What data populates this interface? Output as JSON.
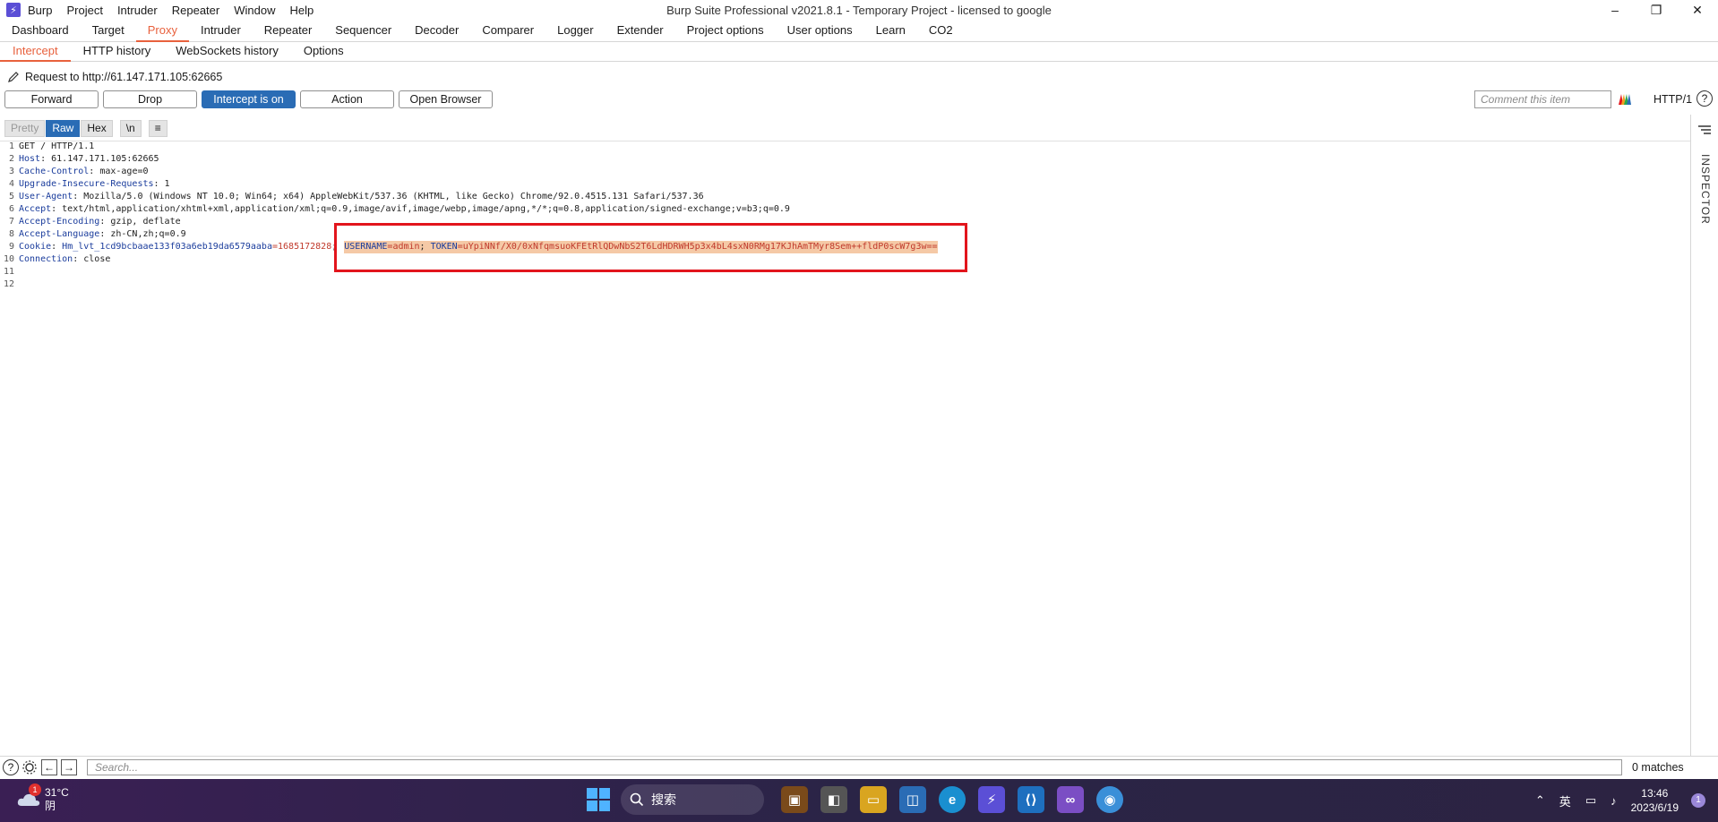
{
  "window": {
    "title": "Burp Suite Professional v2021.8.1 - Temporary Project - licensed to google",
    "logo": "burp-logo",
    "menu": [
      "Burp",
      "Project",
      "Intruder",
      "Repeater",
      "Window",
      "Help"
    ],
    "controls": {
      "minimize": "–",
      "restore": "❐",
      "close": "✕"
    }
  },
  "main_tabs": [
    "Dashboard",
    "Target",
    "Proxy",
    "Intruder",
    "Repeater",
    "Sequencer",
    "Decoder",
    "Comparer",
    "Logger",
    "Extender",
    "Project options",
    "User options",
    "Learn",
    "CO2"
  ],
  "main_tab_active": "Proxy",
  "sub_tabs": [
    "Intercept",
    "HTTP history",
    "WebSockets history",
    "Options"
  ],
  "sub_tab_active": "Intercept",
  "request": {
    "label": "Request to http://61.147.171.105:62665"
  },
  "actions": {
    "forward": "Forward",
    "drop": "Drop",
    "intercept": "Intercept is on",
    "action": "Action",
    "open_browser": "Open Browser"
  },
  "comment": {
    "placeholder": "Comment this item"
  },
  "protocol": "HTTP/1",
  "help": "?",
  "view_modes": {
    "pretty": "Pretty",
    "raw": "Raw",
    "hex": "Hex",
    "newline": "\\n",
    "menu": "≡"
  },
  "inspector_label": "INSPECTOR",
  "code_lines": {
    "l1": {
      "n": "1",
      "text": "GET / HTTP/1.1"
    },
    "l2": {
      "n": "2",
      "key": "Host",
      "val": ": 61.147.171.105:62665"
    },
    "l3": {
      "n": "3",
      "key": "Cache-Control",
      "val": ": max-age=0"
    },
    "l4": {
      "n": "4",
      "key": "Upgrade-Insecure-Requests",
      "val": ": 1"
    },
    "l5": {
      "n": "5",
      "key": "User-Agent",
      "val": ": Mozilla/5.0 (Windows NT 10.0; Win64; x64) AppleWebKit/537.36 (KHTML, like Gecko) Chrome/92.0.4515.131 Safari/537.36"
    },
    "l6": {
      "n": "6",
      "key": "Accept",
      "val": ": text/html,application/xhtml+xml,application/xml;q=0.9,image/avif,image/webp,image/apng,*/*;q=0.8,application/signed-exchange;v=b3;q=0.9"
    },
    "l7": {
      "n": "7",
      "key": "Accept-Encoding",
      "val": ": gzip, deflate"
    },
    "l8": {
      "n": "8",
      "key": "Accept-Language",
      "val": ": zh-CN,zh;q=0.9"
    },
    "l9": {
      "n": "9",
      "key": "Cookie",
      "sep": ": ",
      "ck1": "Hm_lvt_1cd9bcbaae133f03a6eb19da6579aaba",
      "cv1": "=1685172828",
      "semi1": ";",
      "ck2": "USERNAME",
      "cv2": "=admin",
      "semi2": "; ",
      "ck3": "TOKEN",
      "cv3": "=uYpiNNf/X0/0xNfqmsuoKFEtRlQDwNbS2T6LdHDRWH5p3x4bL4sxN0RMg17KJhAmTMyr8Sem++fldP0scW7g3w=="
    },
    "l10": {
      "n": "10",
      "key": "Connection",
      "val": ": close"
    },
    "l11": {
      "n": "11"
    },
    "l12": {
      "n": "12"
    }
  },
  "search": {
    "placeholder": "Search...",
    "matches": "0 matches"
  },
  "taskbar": {
    "weather_temp": "31°C",
    "weather_desc": "阴",
    "weather_badge": "1",
    "search_label": "搜索",
    "ime": "英",
    "time": "13:46",
    "date": "2023/6/19",
    "notification_count": "1"
  },
  "colors": {
    "accent": "#e8613d",
    "primary_button": "#2a6cb5",
    "highlight": "#f5c9a6",
    "annotation_box": "#e2151c"
  }
}
